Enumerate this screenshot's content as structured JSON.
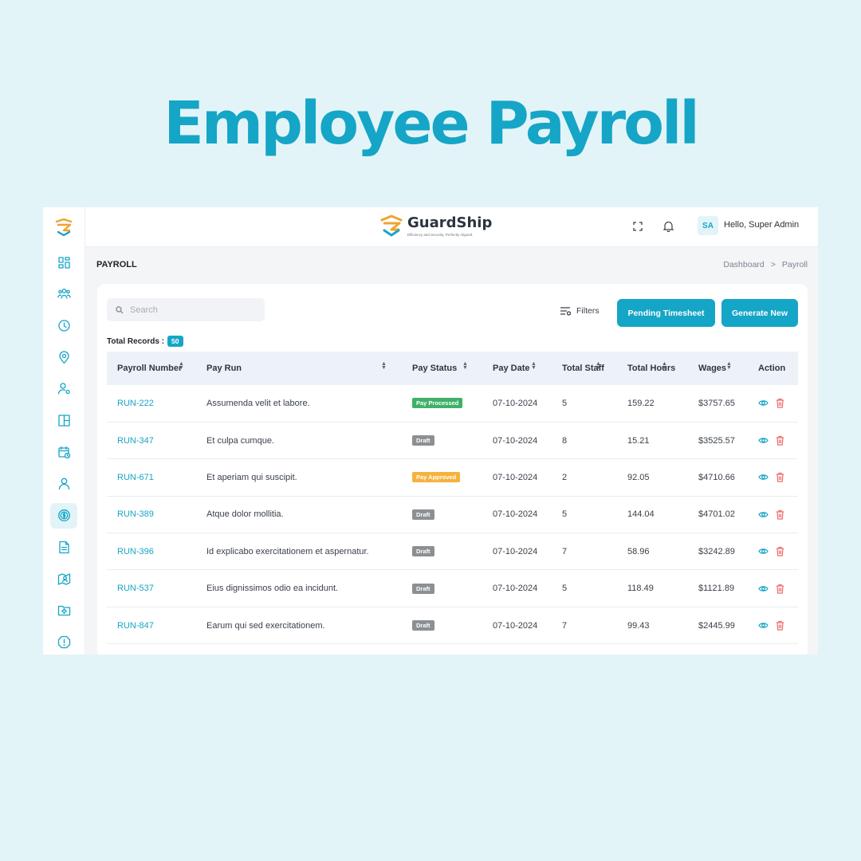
{
  "hero": {
    "title": "Employee Payroll"
  },
  "brand": {
    "name": "GuardShip",
    "tagline": "Efficiency and Security, Perfectly Aligned."
  },
  "topbar": {
    "avatar_initials": "SA",
    "greeting": "Hello, Super Admin"
  },
  "sidebar": {
    "icons": [
      "dashboard-icon",
      "users-icon",
      "clock-icon",
      "location-icon",
      "user-settings-icon",
      "layout-icon",
      "calendar-clock-icon",
      "user-icon",
      "payroll-icon",
      "document-icon",
      "map-user-icon",
      "folder-settings-icon",
      "alert-icon"
    ],
    "active_index": 8
  },
  "page": {
    "title": "PAYROLL",
    "breadcrumb": [
      "Dashboard",
      "Payroll"
    ],
    "breadcrumb_separator": ">"
  },
  "toolbar": {
    "search_placeholder": "Search",
    "filters_label": "Filters",
    "pending_label": "Pending Timesheet",
    "generate_label": "Generate New"
  },
  "records": {
    "label": "Total Records :",
    "count": "50"
  },
  "table": {
    "columns": [
      "Payroll Number",
      "Pay Run",
      "Pay Status",
      "Pay Date",
      "Total Staff",
      "Total Hours",
      "Wages",
      "Action"
    ],
    "rows": [
      {
        "number": "RUN-222",
        "run": "Assumenda velit et labore.",
        "status": "Pay Processed",
        "date": "07-10-2024",
        "staff": "5",
        "hours": "159.22",
        "wages": "$3757.65"
      },
      {
        "number": "RUN-347",
        "run": "Et culpa cumque.",
        "status": "Draft",
        "date": "07-10-2024",
        "staff": "8",
        "hours": "15.21",
        "wages": "$3525.57"
      },
      {
        "number": "RUN-671",
        "run": "Et aperiam qui suscipit.",
        "status": "Pay Approved",
        "date": "07-10-2024",
        "staff": "2",
        "hours": "92.05",
        "wages": "$4710.66"
      },
      {
        "number": "RUN-389",
        "run": "Atque dolor mollitia.",
        "status": "Draft",
        "date": "07-10-2024",
        "staff": "5",
        "hours": "144.04",
        "wages": "$4701.02"
      },
      {
        "number": "RUN-396",
        "run": "Id explicabo exercitationem et aspernatur.",
        "status": "Draft",
        "date": "07-10-2024",
        "staff": "7",
        "hours": "58.96",
        "wages": "$3242.89"
      },
      {
        "number": "RUN-537",
        "run": "Eius dignissimos odio ea incidunt.",
        "status": "Draft",
        "date": "07-10-2024",
        "staff": "5",
        "hours": "118.49",
        "wages": "$1121.89"
      },
      {
        "number": "RUN-847",
        "run": "Earum qui sed exercitationem.",
        "status": "Draft",
        "date": "07-10-2024",
        "staff": "7",
        "hours": "99.43",
        "wages": "$2445.99"
      }
    ]
  },
  "colors": {
    "accent": "#15a5c6",
    "processed": "#3fb06a",
    "approved": "#f5b33d",
    "draft": "#8c8f93",
    "delete": "#ef6a6a"
  }
}
